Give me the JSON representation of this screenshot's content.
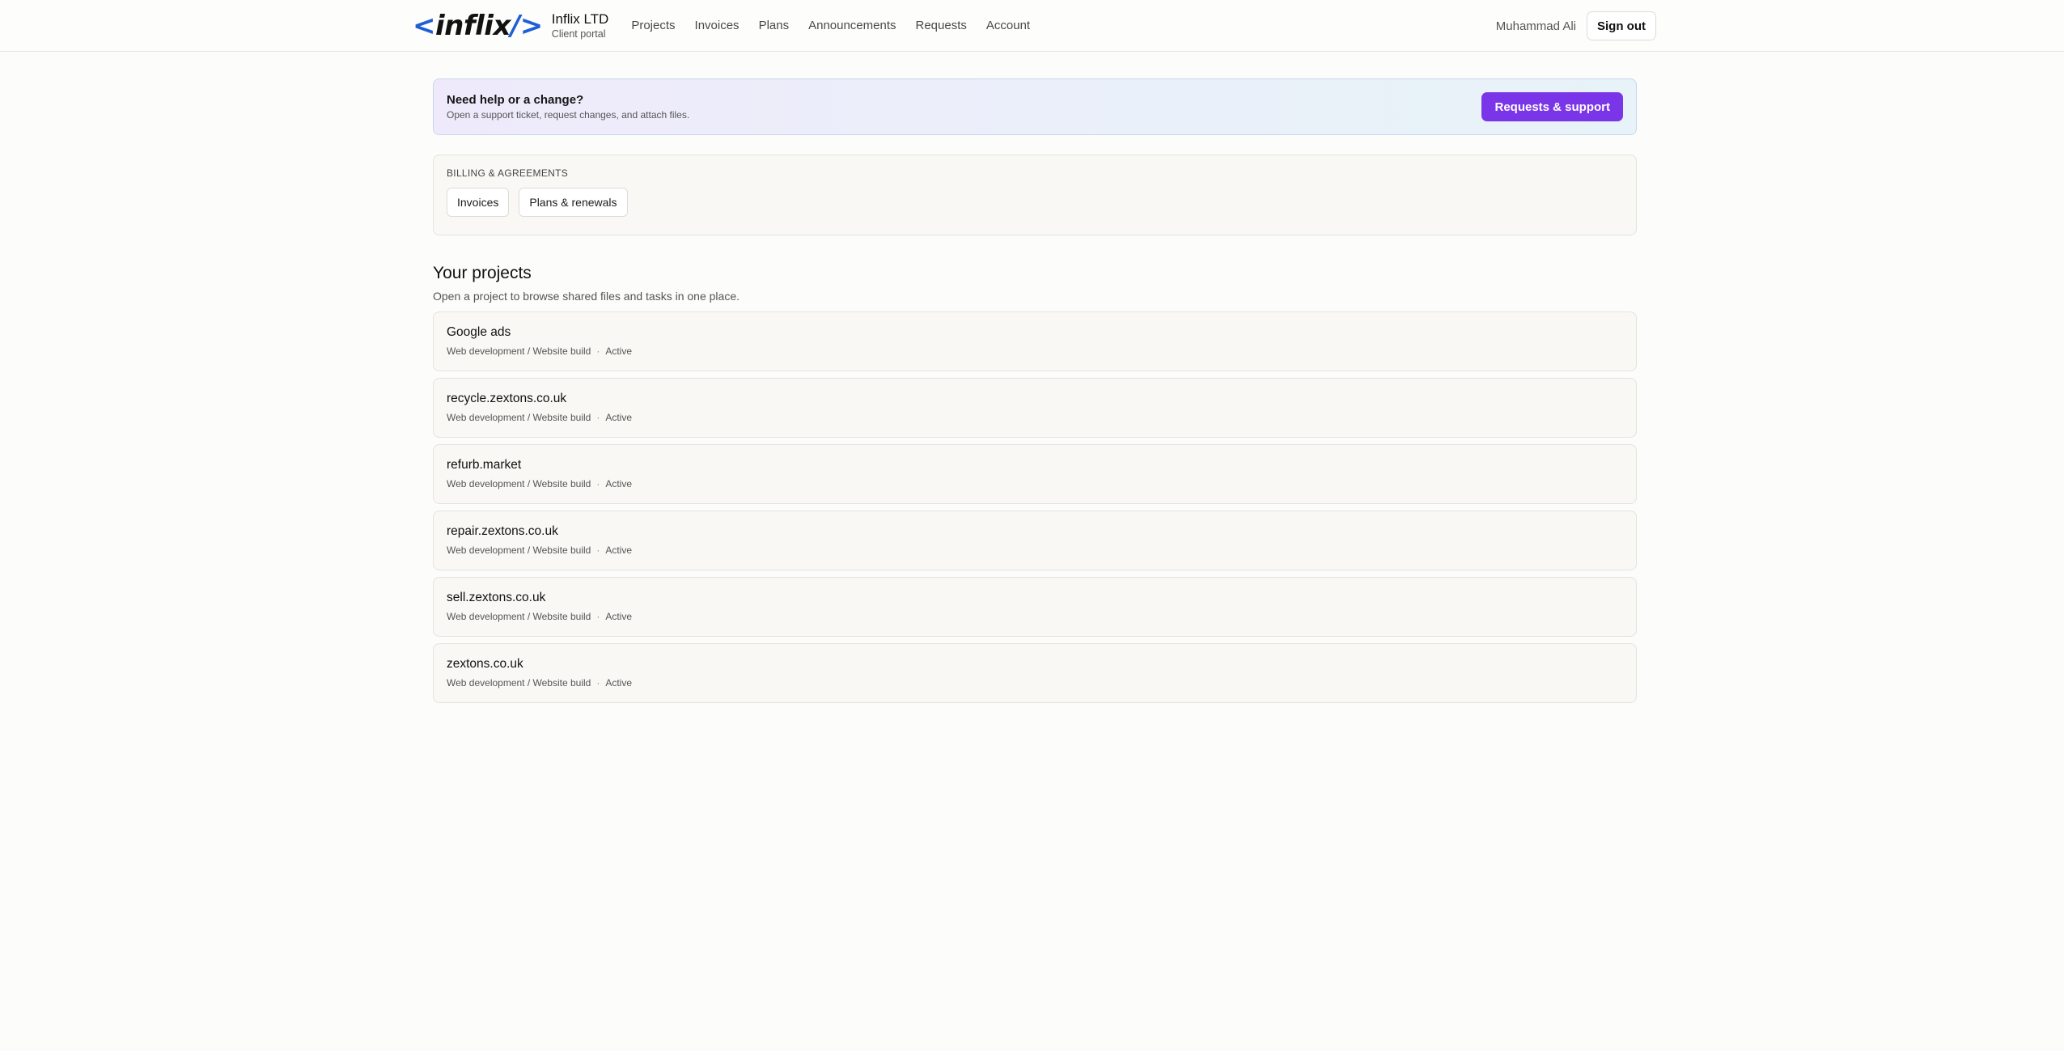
{
  "header": {
    "logo_open": "<",
    "logo_word": "inflix",
    "logo_close": "/>",
    "brand_name": "Inflix LTD",
    "brand_sub": "Client portal",
    "nav": [
      "Projects",
      "Invoices",
      "Plans",
      "Announcements",
      "Requests",
      "Account"
    ],
    "user_name": "Muhammad Ali",
    "signout_label": "Sign out"
  },
  "help_banner": {
    "title": "Need help or a change?",
    "subtitle": "Open a support ticket, request changes, and attach files.",
    "button_label": "Requests & support"
  },
  "billing": {
    "label": "BILLING & AGREEMENTS",
    "buttons": [
      "Invoices",
      "Plans & renewals"
    ]
  },
  "projects": {
    "title": "Your projects",
    "subtitle": "Open a project to browse shared files and tasks in one place.",
    "separator": "·",
    "items": [
      {
        "name": "Google ads",
        "category": "Web development / Website build",
        "status": "Active"
      },
      {
        "name": "recycle.zextons.co.uk",
        "category": "Web development / Website build",
        "status": "Active"
      },
      {
        "name": "refurb.market",
        "category": "Web development / Website build",
        "status": "Active"
      },
      {
        "name": "repair.zextons.co.uk",
        "category": "Web development / Website build",
        "status": "Active"
      },
      {
        "name": "sell.zextons.co.uk",
        "category": "Web development / Website build",
        "status": "Active"
      },
      {
        "name": "zextons.co.uk",
        "category": "Web development / Website build",
        "status": "Active"
      }
    ]
  },
  "colors": {
    "accent": "#7b35e8",
    "logo_bracket": "#1f5fd6",
    "page_bg": "#fcfcfa"
  }
}
